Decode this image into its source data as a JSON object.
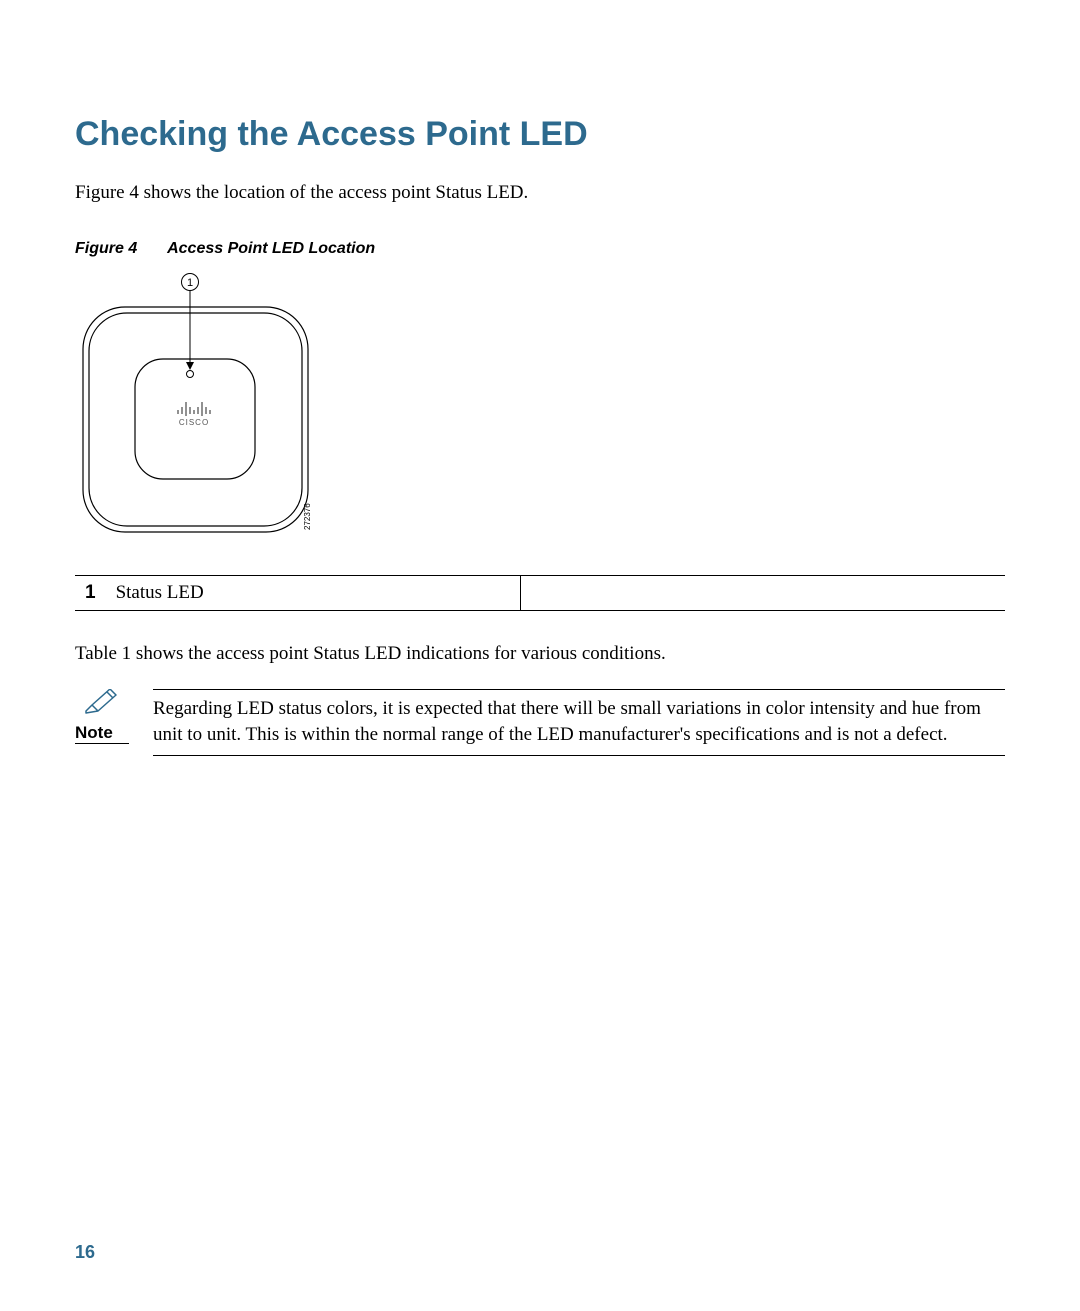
{
  "heading": "Checking the Access Point LED",
  "intro": "Figure 4 shows the location of the access point Status LED.",
  "figure": {
    "label": "Figure 4",
    "title": "Access Point LED Location",
    "callout_number": "1",
    "diagram_id": "272376",
    "logo_text": "CISCO"
  },
  "legend": {
    "num": "1",
    "label": "Status LED"
  },
  "table_ref": "Table 1 shows the access point Status LED indications for various conditions.",
  "note": {
    "label": "Note",
    "text": "Regarding LED status colors, it is expected that there will be small variations in color intensity and hue from unit to unit.  This is within the normal range of the LED manufacturer's specifications and is not a defect."
  },
  "page_number": "16"
}
